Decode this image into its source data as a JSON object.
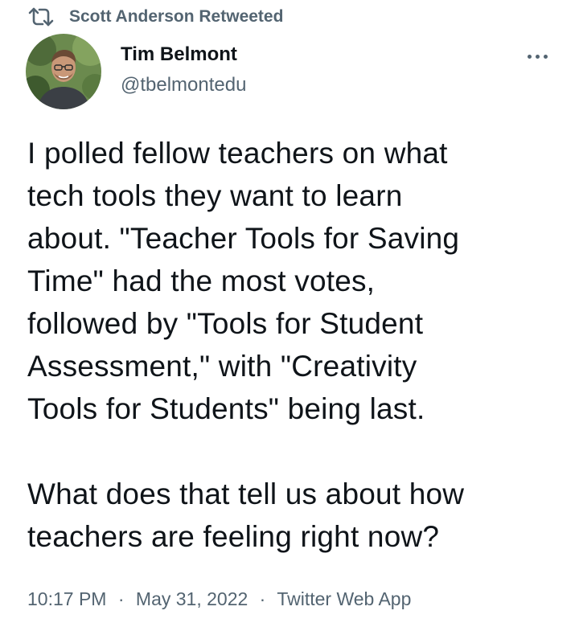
{
  "retweet": {
    "icon": "retweet-icon",
    "text": "Scott Anderson Retweeted"
  },
  "author": {
    "avatar": "avatar",
    "display_name": "Tim Belmont",
    "handle": "@tbelmontedu"
  },
  "more_icon": "more-horizontal-icon",
  "tweet": {
    "paragraph1_lines": [
      "I polled fellow teachers on what",
      "tech tools they want to learn",
      "about. \"Teacher Tools for Saving",
      "Time\" had the most votes,",
      "followed by \"Tools for Student",
      "Assessment,\" with \"Creativity",
      "Tools for Students\" being last."
    ],
    "paragraph2_lines": [
      "What does that tell us about how",
      "teachers are feeling right now?"
    ]
  },
  "meta": {
    "time": "10:17 PM",
    "separator": "·",
    "date": "May 31, 2022",
    "source": "Twitter Web App"
  },
  "colors": {
    "text": "#0f1419",
    "secondary": "#536471",
    "background": "#ffffff"
  }
}
